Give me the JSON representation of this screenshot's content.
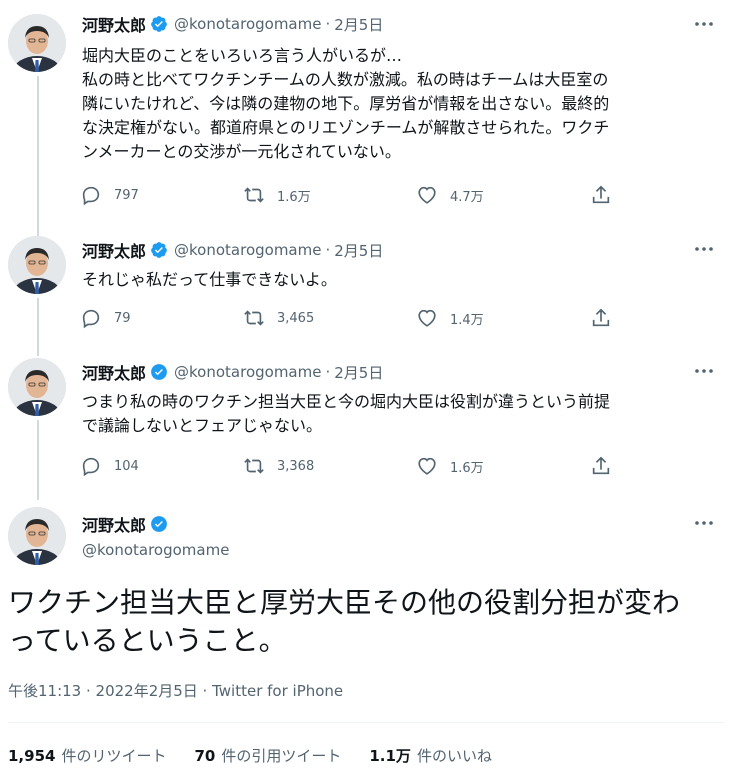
{
  "author": {
    "name": "河野太郎",
    "handle": "@konotarogomame"
  },
  "tweets": [
    {
      "date": "2月5日",
      "lines": [
        "堀内大臣のことをいろいろ言う人がいるが…",
        "私の時と比べてワクチンチームの人数が激減。私の時はチームは大臣室の",
        "隣にいたけれど、今は隣の建物の地下。厚労省が情報を出さない。最終的",
        "な決定権がない。都道府県とのリエゾンチームが解散させられた。ワクチ",
        "ンメーカーとの交渉が一元化されていない。"
      ],
      "replies": "797",
      "retweets": "1.6万",
      "likes": "4.7万"
    },
    {
      "date": "2月5日",
      "lines": [
        "それじゃ私だって仕事できないよ。"
      ],
      "replies": "79",
      "retweets": "3,465",
      "likes": "1.4万"
    },
    {
      "date": "2月5日",
      "lines": [
        "つまり私の時のワクチン担当大臣と今の堀内大臣は役割が違うという前提",
        "で議論しないとフェアじゃない。"
      ],
      "replies": "104",
      "retweets": "3,368",
      "likes": "1.6万"
    }
  ],
  "main_tweet": {
    "text_lines": [
      "ワクチン担当大臣と厚労大臣その他の役割分担が変わ",
      "っているということ。"
    ],
    "timestamp": "午後11:13 · 2022年2月5日 · Twitter for iPhone",
    "stats": {
      "retweets_count": "1,954",
      "retweets_label": "件のリツイート",
      "quotes_count": "70",
      "quotes_label": "件の引用ツイート",
      "likes_count": "1.1万",
      "likes_label": "件のいいね"
    }
  },
  "colors": {
    "verified_badge": "#1d9bf0",
    "secondary_text": "#536471",
    "thread_line": "#cfd9de"
  }
}
